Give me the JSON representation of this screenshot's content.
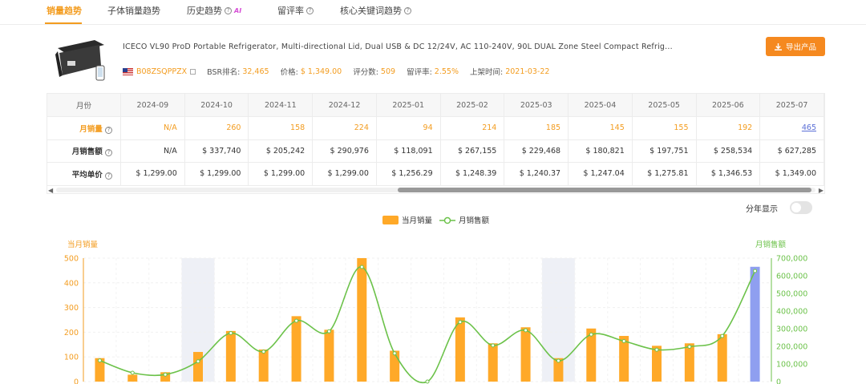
{
  "tabs": [
    {
      "label": "销量趋势",
      "active": true,
      "help": false,
      "ai": false
    },
    {
      "label": "子体销量趋势",
      "active": false,
      "help": false,
      "ai": false
    },
    {
      "label": "历史趋势",
      "active": false,
      "help": true,
      "ai": true
    },
    {
      "label": "留评率",
      "active": false,
      "help": true,
      "ai": false
    },
    {
      "label": "核心关键词趋势",
      "active": false,
      "help": true,
      "ai": false
    }
  ],
  "ai_badge": "AI",
  "product": {
    "title": "ICECO VL90 ProD Portable Refrigerator, Multi-directional Lid, Dual USB & DC 12/24V, AC 110-240V, 90L DUAL Zone Steel Compact Refrig...",
    "asin": "B08ZSQPPZX",
    "bsr_label": "BSR排名:",
    "bsr_value": "32,465",
    "price_label": "价格:",
    "price_value": "$ 1,349.00",
    "ratings_label": "评分数:",
    "ratings_value": "509",
    "review_rate_label": "留评率:",
    "review_rate_value": "2.55%",
    "launch_label": "上架时间:",
    "launch_value": "2021-03-22",
    "export_label": "导出产品"
  },
  "table": {
    "header_label": "月份",
    "months": [
      "2024-09",
      "2024-10",
      "2024-11",
      "2024-12",
      "2025-01",
      "2025-02",
      "2025-03",
      "2025-04",
      "2025-05",
      "2025-06",
      "2025-07"
    ],
    "rows": [
      {
        "label": "月销量",
        "values": [
          "N/A",
          "260",
          "158",
          "224",
          "94",
          "214",
          "185",
          "145",
          "155",
          "192",
          "465"
        ]
      },
      {
        "label": "月销售额",
        "values": [
          "N/A",
          "$ 337,740",
          "$ 205,242",
          "$ 290,976",
          "$ 118,091",
          "$ 267,155",
          "$ 229,468",
          "$ 180,821",
          "$ 197,751",
          "$ 258,534",
          "$ 627,285"
        ]
      },
      {
        "label": "平均单价",
        "values": [
          "$ 1,299.00",
          "$ 1,299.00",
          "$ 1,299.00",
          "$ 1,299.00",
          "$ 1,256.29",
          "$ 1,248.39",
          "$ 1,240.37",
          "$ 1,247.04",
          "$ 1,275.81",
          "$ 1,346.53",
          "$ 1,349.00"
        ]
      }
    ]
  },
  "year_toggle_label": "分年显示",
  "colors": {
    "accent": "#f39c1f",
    "bar": "#ffa928",
    "bar_current": "#8f9ff0",
    "line": "#6cc24a",
    "band": "#eef0f6"
  },
  "chart_data": {
    "type": "bar",
    "legend": [
      {
        "name": "当月销量",
        "kind": "bar"
      },
      {
        "name": "月销售额",
        "kind": "line"
      }
    ],
    "left_axis_label": "当月销量",
    "right_axis_label": "月销售额",
    "left_ticks": [
      "0",
      "100",
      "200",
      "300",
      "400",
      "500"
    ],
    "right_ticks": [
      "0",
      "100,000",
      "200,000",
      "300,000",
      "400,000",
      "500,000",
      "600,000",
      "700,000"
    ],
    "ylim_left": [
      0,
      500
    ],
    "ylim_right": [
      0,
      700000
    ],
    "bars": [
      95,
      28,
      38,
      120,
      205,
      130,
      265,
      210,
      500,
      125,
      0,
      260,
      155,
      220,
      95,
      215,
      185,
      145,
      155,
      192,
      465
    ],
    "line": [
      120000,
      50000,
      40000,
      115000,
      275000,
      170000,
      345000,
      285000,
      650000,
      160000,
      0,
      337740,
      205242,
      290976,
      118091,
      267155,
      229468,
      180821,
      197751,
      258534,
      627285
    ],
    "highlight_last": true,
    "bands": [
      3,
      14
    ]
  }
}
